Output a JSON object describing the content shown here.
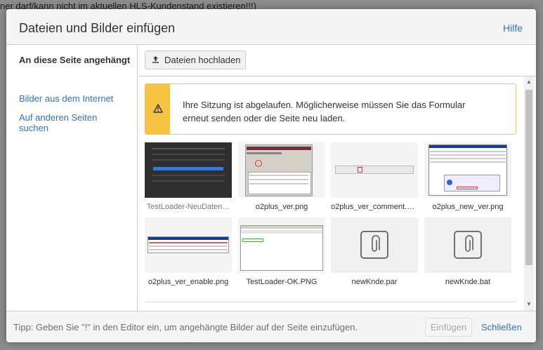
{
  "background": {
    "top_line": "ner darf/kann nicht im aktuellen HLS-Kundenstand existieren!!!)"
  },
  "dialog": {
    "title": "Dateien und Bilder einfügen",
    "help_label": "Hilfe"
  },
  "sidebar": {
    "items": [
      {
        "label": "An diese Seite angehängt",
        "active": true
      },
      {
        "label": "Bilder aus dem Internet",
        "active": false
      },
      {
        "label": "Auf anderen Seiten suchen",
        "active": false
      }
    ]
  },
  "toolbar": {
    "upload_icon": "upload-icon",
    "upload_label": "Dateien hochladen"
  },
  "warning": {
    "icon": "warning-icon",
    "text": "Ihre Sitzung ist abgelaufen. Möglicherweise müssen Sie das Formular erneut senden oder die Seite neu laden."
  },
  "files": [
    {
      "name": "TestLoader-NeuDaten…",
      "kind": "image"
    },
    {
      "name": "o2plus_ver.png",
      "kind": "image"
    },
    {
      "name": "o2plus_ver_comment.p…",
      "kind": "image"
    },
    {
      "name": "o2plus_new_ver.png",
      "kind": "image"
    },
    {
      "name": "o2plus_ver_enable.png",
      "kind": "image"
    },
    {
      "name": "TestLoader-OK.PNG",
      "kind": "image"
    },
    {
      "name": "newKnde.par",
      "kind": "attachment"
    },
    {
      "name": "newKnde.bat",
      "kind": "attachment"
    }
  ],
  "footer": {
    "tip": "Tipp: Geben Sie \"!\" in den Editor ein, um angehängte Bilder auf der Seite einzufügen.",
    "insert_label": "Einfügen",
    "close_label": "Schließen"
  },
  "colors": {
    "link": "#3572b0",
    "warning": "#f6c342"
  }
}
